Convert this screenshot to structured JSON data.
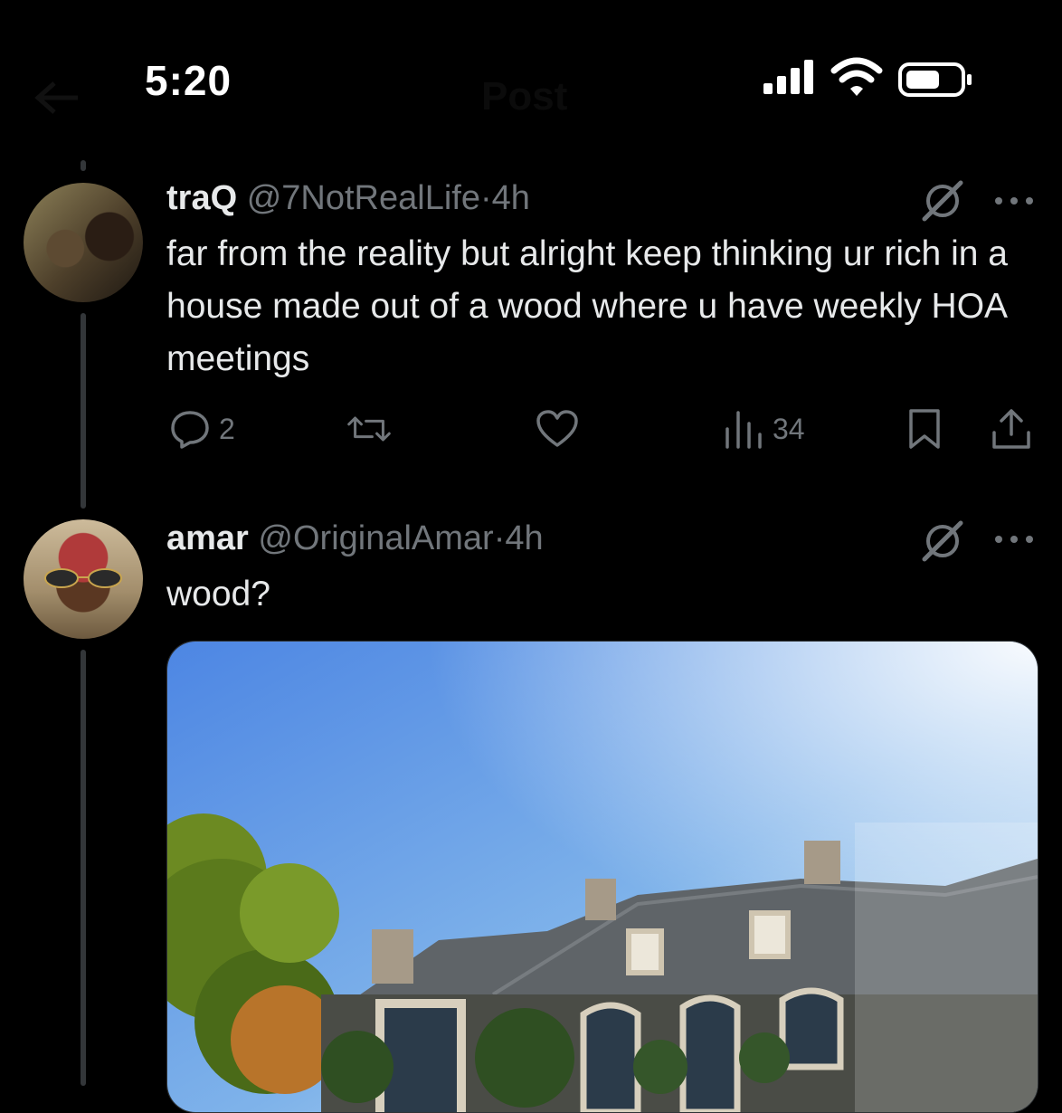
{
  "status_bar": {
    "time": "5:20"
  },
  "header": {
    "title": "Post"
  },
  "posts": [
    {
      "name": "traQ",
      "handle": "@7NotRealLife",
      "separator": "·",
      "time": "4h",
      "text": "far from the reality but alright keep thinking ur rich in a house made out of a wood where u have weekly HOA meetings",
      "replies": "2",
      "views": "34"
    },
    {
      "name": "amar",
      "handle": "@OriginalAmar",
      "separator": "·",
      "time": "4h",
      "text": "wood?"
    }
  ],
  "icons": {
    "status": [
      "cellular-signal-icon",
      "wifi-icon",
      "battery-icon"
    ],
    "post_actions": [
      "reply-icon",
      "repost-icon",
      "like-icon",
      "views-icon",
      "bookmark-icon",
      "share-icon"
    ],
    "post_header": [
      "grok-icon",
      "more-icon"
    ]
  },
  "colors": {
    "background": "#000000",
    "text": "#e7e9ea",
    "secondary": "#71767b",
    "thread_line": "#333639"
  }
}
